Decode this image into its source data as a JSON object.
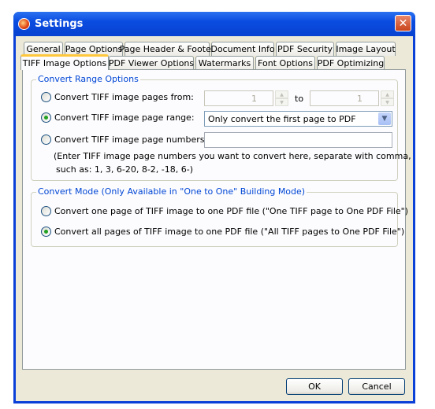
{
  "window": {
    "title": "Settings",
    "close_icon": "close-x-icon",
    "app_icon": "app-logo-icon"
  },
  "tabs_row1": [
    "General",
    "Page Options",
    "Page Header & Footer",
    "Document Info",
    "PDF Security",
    "Image Layout"
  ],
  "tabs_row2": [
    "TIFF Image Options",
    "PDF Viewer Options",
    "Watermarks",
    "Font Options",
    "PDF Optimizing"
  ],
  "active_tab": "TIFF Image Options",
  "range_group": {
    "label": "Convert Range Options",
    "from_label": "Convert TIFF image pages from:",
    "from_value": "1",
    "to_label": "to",
    "to_value": "1",
    "range_label": "Convert TIFF image page range:",
    "range_value": "Only convert the first page to PDF",
    "numbers_label": "Convert TIFF image page numbers:",
    "numbers_value": "",
    "note1": "(Enter TIFF image page numbers you want to convert here, separate with comma,",
    "note2": "such as: 1, 3, 6-20, 8-2, -18, 6-)",
    "selected": "range"
  },
  "mode_group": {
    "label": "Convert Mode (Only Available in \"One to One\" Building Mode)",
    "option1": "Convert one page of TIFF image to one PDF file (\"One TIFF page to One PDF File\")",
    "option2": "Convert all pages of TIFF image to one PDF file (\"All TIFF pages to One PDF File\")",
    "selected": "option2"
  },
  "buttons": {
    "ok": "OK",
    "cancel": "Cancel"
  },
  "colors": {
    "titlebar": "#0a4ce0",
    "group_label": "#0046d5",
    "active_tab_accent": "#ffc83c"
  }
}
